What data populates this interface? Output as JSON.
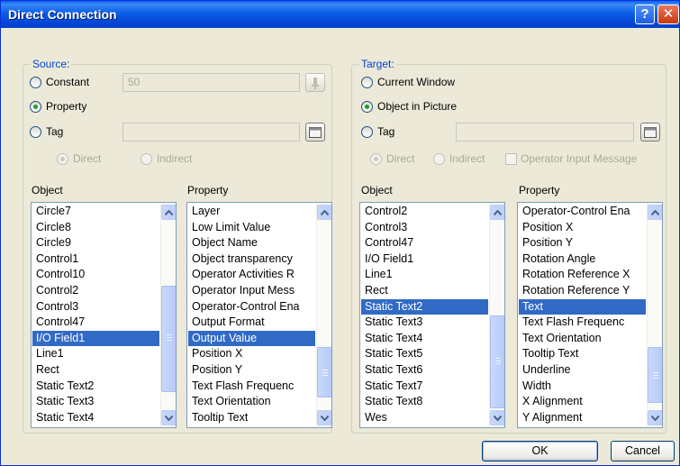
{
  "window": {
    "title": "Direct Connection",
    "help_label": "?",
    "close_label": "✕"
  },
  "source": {
    "legend": "Source:",
    "constant_label": "Constant",
    "constant_value": "50",
    "property_label": "Property",
    "tag_label": "Tag",
    "tag_value": "",
    "direct_label": "Direct",
    "indirect_label": "Indirect",
    "object_header": "Object",
    "property_header": "Property",
    "objects": [
      "Circle7",
      "Circle8",
      "Circle9",
      "Control1",
      "Control10",
      "Control2",
      "Control3",
      "Control47",
      "I/O Field1",
      "Line1",
      "Rect",
      "Static Text2",
      "Static Text3",
      "Static Text4"
    ],
    "selected_object": "I/O Field1",
    "properties": [
      "Layer",
      "Low Limit Value",
      "Object Name",
      "Object transparency",
      "Operator Activities R",
      "Operator Input Mess",
      "Operator-Control Ena",
      "Output Format",
      "Output Value",
      "Position X",
      "Position Y",
      "Text Flash Frequenc",
      "Text Orientation",
      "Tooltip Text"
    ],
    "selected_property": "Output Value"
  },
  "target": {
    "legend": "Target:",
    "current_window_label": "Current Window",
    "object_in_picture_label": "Object in Picture",
    "tag_label": "Tag",
    "tag_value": "",
    "direct_label": "Direct",
    "indirect_label": "Indirect",
    "operator_input_label": "Operator Input Message",
    "object_header": "Object",
    "property_header": "Property",
    "objects": [
      "Control2",
      "Control3",
      "Control47",
      "I/O Field1",
      "Line1",
      "Rect",
      "Static Text2",
      "Static Text3",
      "Static Text4",
      "Static Text5",
      "Static Text6",
      "Static Text7",
      "Static Text8",
      "Wes"
    ],
    "selected_object": "Static Text2",
    "properties": [
      "Operator-Control Ena",
      "Position X",
      "Position Y",
      "Rotation Angle",
      "Rotation Reference X",
      "Rotation Reference Y",
      "Text",
      "Text Flash Frequenc",
      "Text Orientation",
      "Tooltip Text",
      "Underline",
      "Width",
      "X Alignment",
      "Y Alignment"
    ],
    "selected_property": "Text"
  },
  "buttons": {
    "ok_label": "OK",
    "cancel_label": "Cancel"
  },
  "colors": {
    "title_bar": "#0b5de8",
    "selection": "#316ac5",
    "group_legend": "#0046d5",
    "dialog_bg": "#ece9d8"
  },
  "icons": {
    "browse": "browse-icon",
    "connector": "connector-icon",
    "scroll_up": "chevron-up-icon",
    "scroll_down": "chevron-down-icon"
  }
}
